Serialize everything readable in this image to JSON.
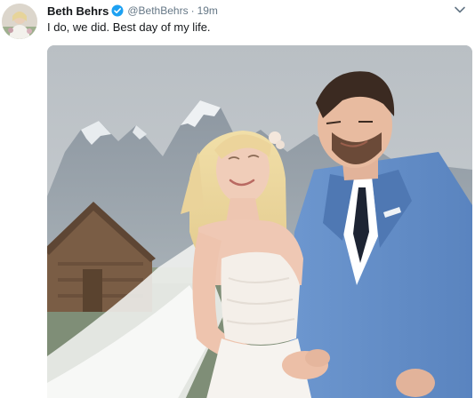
{
  "tweet": {
    "author": {
      "display_name": "Beth Behrs",
      "handle": "@BethBehrs",
      "verified": true,
      "avatar_icon": "profile-photo"
    },
    "separator": "·",
    "timestamp": "19m",
    "text": "I do, we did. Best day of my life.",
    "menu_icon": "chevron-down-icon",
    "media": {
      "type": "photo",
      "content": "wedding-photo"
    }
  },
  "colors": {
    "verified_badge": "#1da1f2",
    "secondary_text": "#657786",
    "primary_text": "#14171a"
  }
}
